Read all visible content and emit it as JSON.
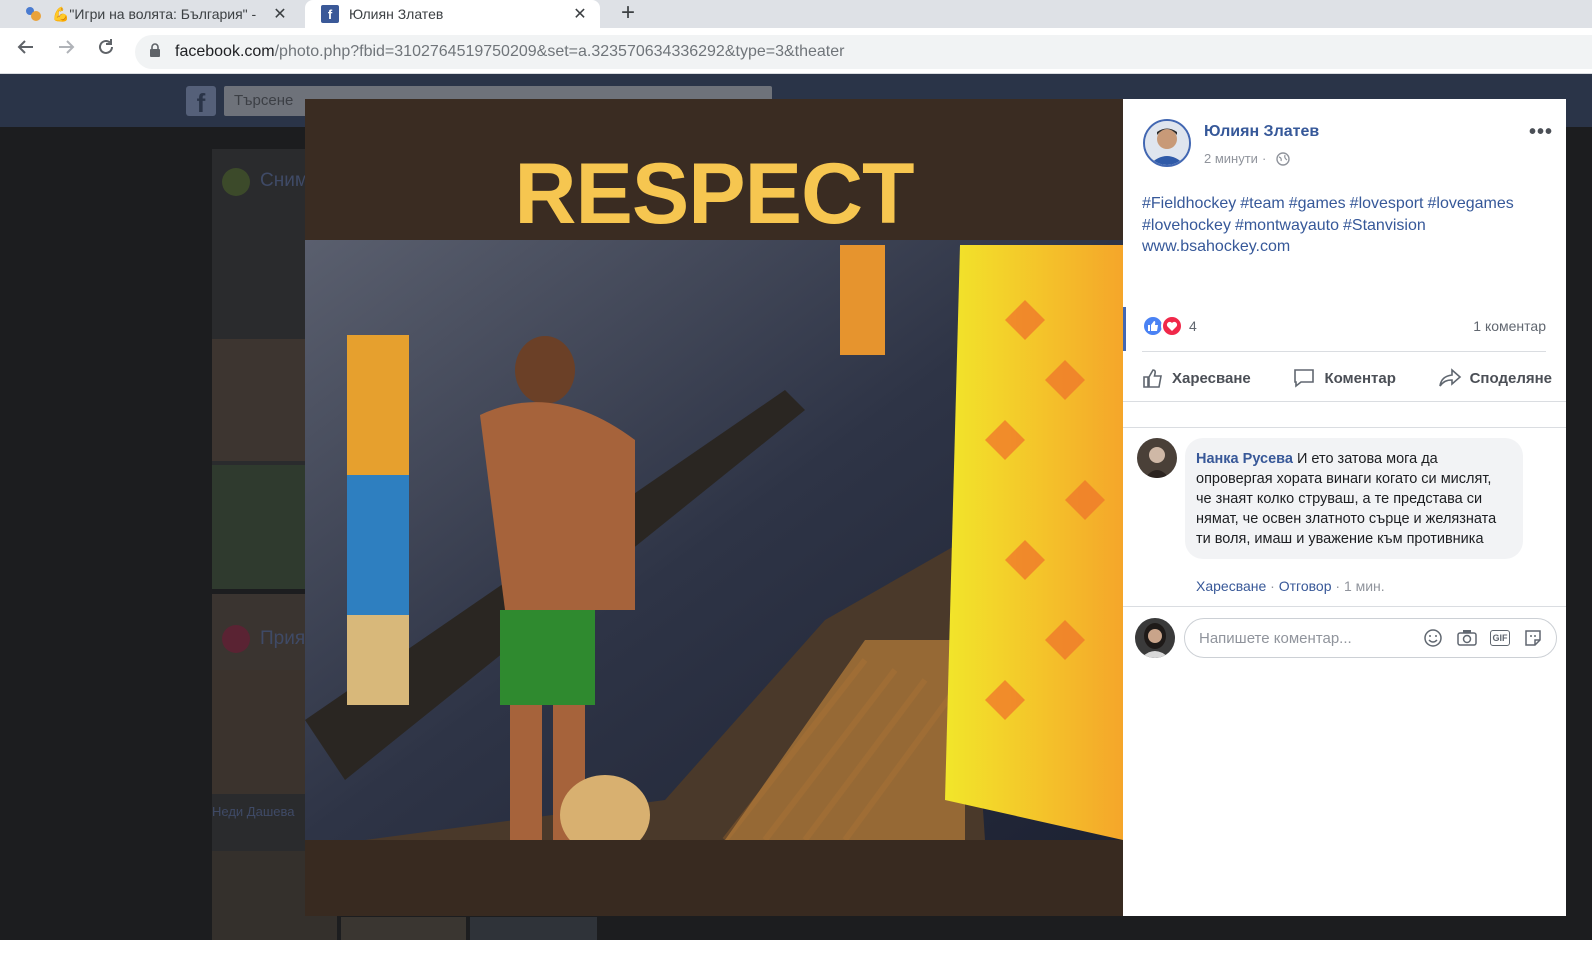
{
  "browser": {
    "tabs": [
      {
        "title": "💪\"Игри на волята: България\" -",
        "active": false
      },
      {
        "title": "Юлиян Златев",
        "active": true
      }
    ],
    "new_tab": "+",
    "url_domain": "facebook.com",
    "url_path": "/photo.php?fbid=3102764519750209&set=a.323570634336292&type=3&theater"
  },
  "fb_background": {
    "search_placeholder": "Търсене",
    "section1_label": "Сним",
    "section2_label": "Прия",
    "friend_name": "Неди Дашева"
  },
  "photo": {
    "banner_text": "RESPECT"
  },
  "post": {
    "author": "Юлиян Златев",
    "time": "2 минути",
    "more_label": "•••",
    "text_tags": [
      "#Fieldhockey",
      "#team",
      "#games",
      "#lovesport",
      "#lovegames",
      "#lovehockey",
      "#montwayauto",
      "#Stanvision"
    ],
    "text_link": "www.bsahockey.com",
    "reaction_count": "4",
    "comment_count": "1 коментар",
    "actions": {
      "like": "Харесване",
      "comment": "Коментар",
      "share": "Споделяне"
    }
  },
  "comment": {
    "author": "Нанка Русева",
    "text": "И ето затова мога да опровергая хората винаги когато си мислят, че знаят колко струваш, а те представа си нямат, че освен златното сърце и желязната ти воля, имаш и уважение към противника",
    "like": "Харесване",
    "reply": "Отговор",
    "time": "1 мин."
  },
  "compose": {
    "placeholder": "Напишете коментар...",
    "gif_label": "GIF"
  },
  "colors": {
    "fb_blue": "#4267b2",
    "link_blue": "#365899",
    "banner_yellow": "#f6c650"
  }
}
